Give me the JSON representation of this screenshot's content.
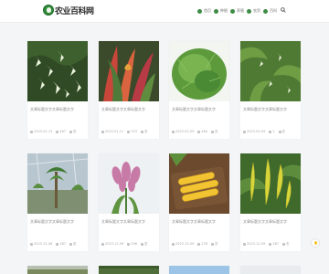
{
  "header": {
    "site_title": "农业百科网",
    "nav": [
      {
        "label": "首页"
      },
      {
        "label": "种植"
      },
      {
        "label": "养殖"
      },
      {
        "label": "农资"
      },
      {
        "label": "百科"
      }
    ]
  },
  "cards": [
    {
      "title": "文章标题文字文章标题文字",
      "date": "2023-02-13",
      "views": "467",
      "author": "农"
    },
    {
      "title": "文章标题文字文章标题文字",
      "date": "2023-01-11",
      "views": "323",
      "author": "农"
    },
    {
      "title": "文章标题文字文章标题文字",
      "date": "2023-02-09",
      "views": "464",
      "author": "农"
    },
    {
      "title": "文章标题文字文章标题文字",
      "date": "2023-02-09",
      "views": "2",
      "author": "农"
    },
    {
      "title": "文章标题文字文章标题文字",
      "date": "2023-12-08",
      "views": "287",
      "author": "农"
    },
    {
      "title": "文章标题文字文章标题文字",
      "date": "2023-12-09",
      "views": "296",
      "author": "农"
    },
    {
      "title": "文章标题文字文章标题文字",
      "date": "2023-12-09",
      "views": "278",
      "author": "农"
    },
    {
      "title": "文章标题文字文章标题文字",
      "date": "2023-12-09",
      "views": "267",
      "author": "农"
    }
  ],
  "colors": {
    "brand_green": "#3d8b45",
    "background": "#f4f5f7"
  }
}
